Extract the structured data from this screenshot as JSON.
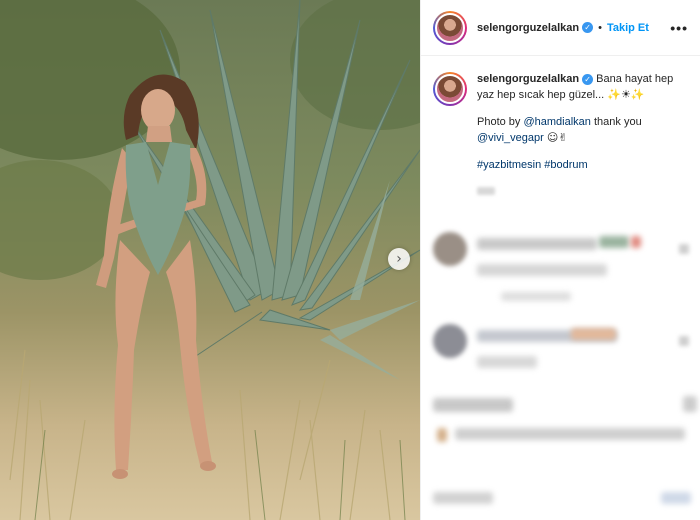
{
  "post": {
    "username": "selengorguzelalkan",
    "follow_label": "Takip Et",
    "dot_separator": "•",
    "more_label": "•••",
    "caption": {
      "text_1": "Bana hayat hep",
      "text_2": "yaz hep sıcak hep güzel...",
      "emojis_1": "✨☀✨",
      "photo_by": "Photo by",
      "mention_1": "@hamdialkan",
      "thanks": "thank you",
      "mention_2": "@vivi_vegapr",
      "emojis_2": "☺✌",
      "hashtag_1": "#yazbitmesin",
      "hashtag_2": "#bodrum"
    }
  },
  "icons": {
    "verified": "verified-badge-icon",
    "next": "chevron-right-icon",
    "more": "more-options-icon"
  },
  "colors": {
    "follow": "#0095f6",
    "verified": "#3897f0",
    "link": "#00376b"
  }
}
